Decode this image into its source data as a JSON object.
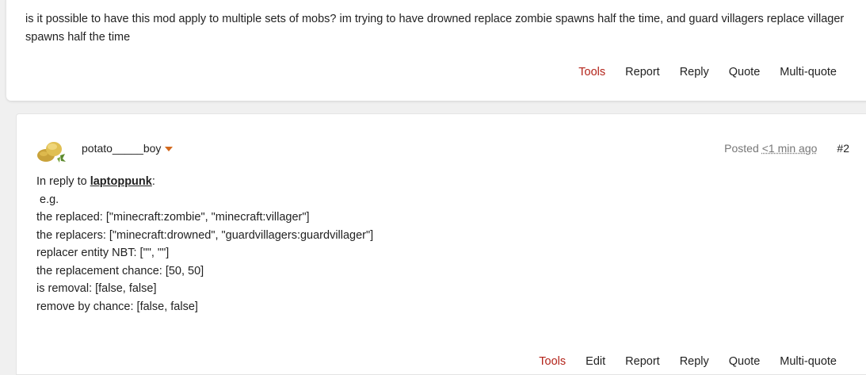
{
  "post1": {
    "text": "is it possible to have this mod apply to multiple sets of mobs? im trying to have drowned replace zombie spawns half the time, and guard villagers replace villager spawns half the time",
    "actions": [
      "Tools",
      "Report",
      "Reply",
      "Quote",
      "Multi-quote"
    ]
  },
  "post2": {
    "username": "potato_____boy",
    "posted_label": "Posted",
    "time": "<1 min ago",
    "number": "#2",
    "reply_prefix": "In reply to ",
    "mention": "laptoppunk",
    "mention_suffix": ":",
    "lines": [
      " e.g.",
      "the replaced: [\"minecraft:zombie\", \"minecraft:villager\"]",
      "the replacers: [\"minecraft:drowned\", \"guardvillagers:guardvillager\"]",
      "replacer entity NBT: [\"\", \"\"]",
      "the replacement chance: [50, 50]",
      "is removal: [false, false]",
      "remove by chance: [false, false]"
    ],
    "actions": [
      "Tools",
      "Edit",
      "Report",
      "Reply",
      "Quote",
      "Multi-quote"
    ]
  },
  "colors": {
    "tools": "#b3241a",
    "caret": "#d2691e"
  }
}
